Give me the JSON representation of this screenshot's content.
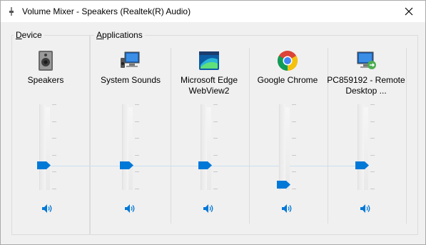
{
  "window": {
    "title": "Volume Mixer - Speakers (Realtek(R) Audio)"
  },
  "device_group": {
    "label_access": "D",
    "label_rest": "evice"
  },
  "applications_group": {
    "label_access": "A",
    "label_rest": "pplications"
  },
  "channels": [
    {
      "name": "Speakers",
      "icon": "speaker-icon",
      "volume": 0.5
    },
    {
      "name": "System Sounds",
      "icon": "system-sounds-icon",
      "volume": 0.5
    },
    {
      "name": "Microsoft Edge WebView2",
      "icon": "edge-webview-icon",
      "volume": 0.5
    },
    {
      "name": "Google Chrome",
      "icon": "chrome-icon",
      "volume": 0.1
    },
    {
      "name": "PC859192 - Remote Desktop ...",
      "icon": "remote-desktop-icon",
      "volume": 0.5
    }
  ],
  "colors": {
    "accent": "#0078d7",
    "link_line": "#c9dff0"
  }
}
